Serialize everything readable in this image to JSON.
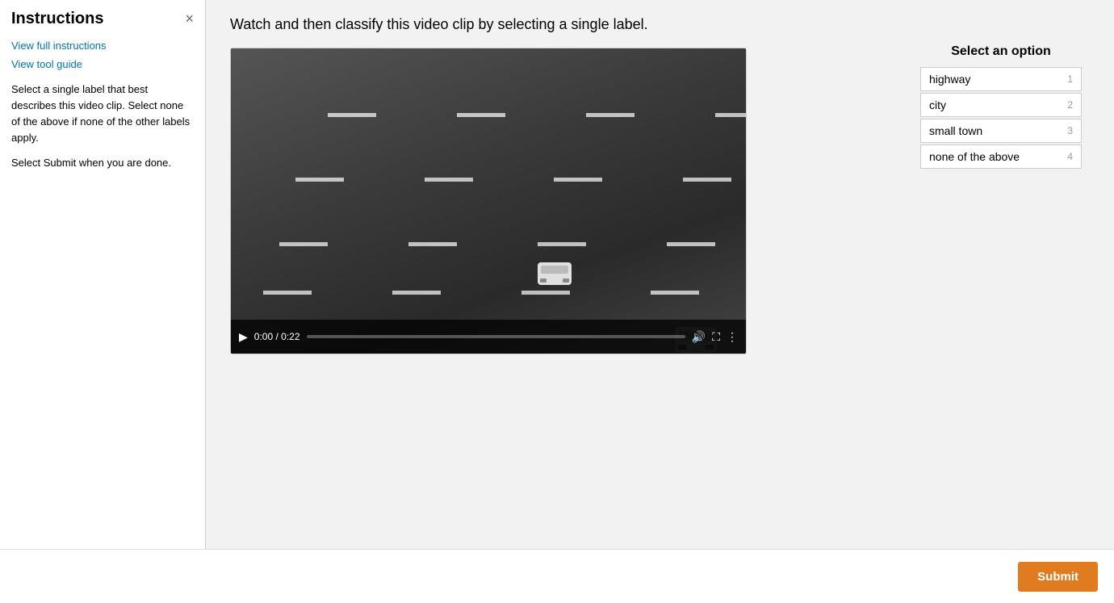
{
  "sidebar": {
    "title": "Instructions",
    "close_label": "×",
    "link_full_instructions": "View full instructions",
    "link_tool_guide": "View tool guide",
    "instruction_text_1": "Select a single label that best describes this video clip. Select none of the above if none of the other labels apply.",
    "instruction_text_2": "Select Submit when you are done."
  },
  "main": {
    "title": "Watch and then classify this video clip by selecting a single label.",
    "video": {
      "time_display": "0:00 / 0:22",
      "play_icon": "▶",
      "volume_icon": "🔊",
      "fullscreen_icon": "⛶",
      "more_icon": "⋮"
    },
    "options_panel": {
      "title": "Select an option",
      "options": [
        {
          "label": "highway",
          "number": "1"
        },
        {
          "label": "city",
          "number": "2"
        },
        {
          "label": "small town",
          "number": "3"
        },
        {
          "label": "none of the above",
          "number": "4"
        }
      ]
    }
  },
  "footer": {
    "submit_label": "Submit"
  }
}
